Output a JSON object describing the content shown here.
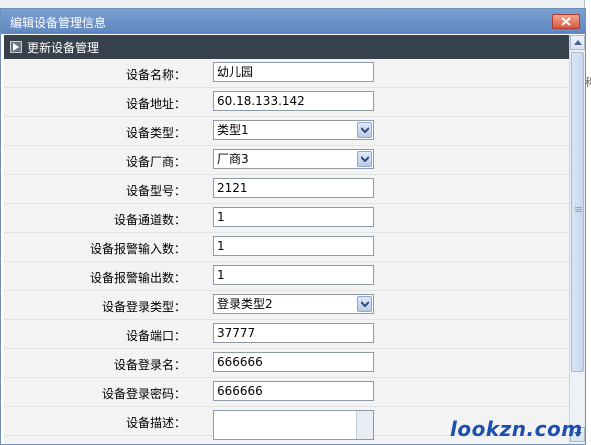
{
  "dialog": {
    "title": "编辑设备管理信息",
    "section_title": "更新设备管理"
  },
  "fields": [
    {
      "label": "设备名称：",
      "type": "text",
      "value": "幼儿园"
    },
    {
      "label": "设备地址：",
      "type": "text",
      "value": "60.18.133.142"
    },
    {
      "label": "设备类型：",
      "type": "select",
      "value": "类型1"
    },
    {
      "label": "设备厂商：",
      "type": "select",
      "value": "厂商3"
    },
    {
      "label": "设备型号：",
      "type": "text",
      "value": "2121"
    },
    {
      "label": "设备通道数：",
      "type": "text",
      "value": "1"
    },
    {
      "label": "设备报警输入数：",
      "type": "text",
      "value": "1"
    },
    {
      "label": "设备报警输出数：",
      "type": "text",
      "value": "1"
    },
    {
      "label": "设备登录类型：",
      "type": "select",
      "value": "登录类型2"
    },
    {
      "label": "设备端口：",
      "type": "text",
      "value": "37777"
    },
    {
      "label": "设备登录名：",
      "type": "text",
      "value": "666666"
    },
    {
      "label": "设备登录密码：",
      "type": "text",
      "value": "666666"
    },
    {
      "label": "设备描述：",
      "type": "textarea",
      "value": ""
    }
  ],
  "background": {
    "right_edge_glyph": "称"
  },
  "watermark": "lookzn.com",
  "icons": {
    "close": "close-icon",
    "section": "play-icon",
    "dropdown": "chevron-down-icon"
  },
  "colors": {
    "titlebar": "#6d93c9",
    "section_bar": "#37414c",
    "close_button": "#d95b42",
    "watermark": "#1c4fb0"
  }
}
